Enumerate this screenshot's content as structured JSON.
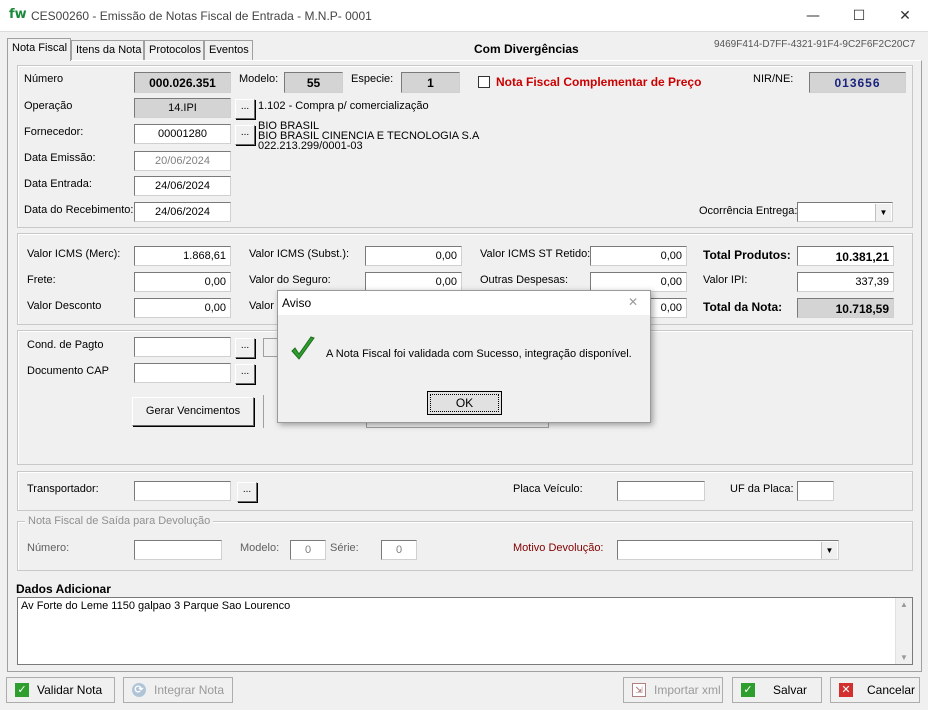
{
  "window": {
    "app_icon": "fw",
    "title": "CES00260 - Emissão de  Notas  Fiscal de Entrada - M.N.P- 0001",
    "minimize": "—",
    "maximize": "☐",
    "close": "✕"
  },
  "tabs": [
    "Nota Fiscal",
    "Itens da Nota",
    "Protocolos",
    "Eventos"
  ],
  "header": {
    "status": "Com Divergências",
    "guid": "9469F414-D7FF-4321-91F4-9C2F6F2C20C7"
  },
  "nota": {
    "numero_label": "Número",
    "numero": "000.026.351",
    "modelo_label": "Modelo:",
    "modelo": "55",
    "especie_label": "Especie:",
    "especie": "1",
    "complementar_label": "Nota Fiscal Complementar de Preço",
    "nir_label": "NIR/NE:",
    "nir": "013656",
    "operacao_label": "Operação",
    "operacao": "14.IPI",
    "operacao_desc": "1.102 - Compra p/ comercialização",
    "fornecedor_label": "Fornecedor:",
    "fornecedor": "00001280",
    "fornecedor_nome1": "BIO BRASIL",
    "fornecedor_nome2": "BIO BRASIL CINENCIA E TECNOLOGIA S.A",
    "fornecedor_cnpj": "022.213.299/0001-03",
    "data_emissao_label": "Data Emissão:",
    "data_emissao": "20/06/2024",
    "data_entrada_label": "Data Entrada:",
    "data_entrada": "24/06/2024",
    "data_recebimento_label": "Data do Recebimento:",
    "data_recebimento": "24/06/2024",
    "ocorrencia_label": "Ocorrência Entrega:",
    "ellipsis": "..."
  },
  "valores": {
    "icms_merc_label": "Valor ICMS (Merc):",
    "icms_merc": "1.868,61",
    "icms_subst_label": "Valor  ICMS (Subst.):",
    "icms_subst": "0,00",
    "icms_st_label": "Valor ICMS ST Retido:",
    "icms_st": "0,00",
    "total_produtos_label": "Total Produtos:",
    "total_produtos": "10.381,21",
    "frete_label": "Frete:",
    "frete": "0,00",
    "seguro_label": "Valor do Seguro:",
    "seguro": "0,00",
    "outras_label": "Outras Despesas:",
    "outras": "0,00",
    "ipi_label": "Valor IPI:",
    "ipi": "337,39",
    "desconto_label": "Valor Desconto",
    "desconto": "0,00",
    "valor_trunc_label": "Valor",
    "valor_trunc": "0,00",
    "total_nota_label": "Total da Nota:",
    "total_nota": "10.718,59"
  },
  "pagamento": {
    "cond_label": "Cond. de Pagto",
    "doc_label": "Documento CAP",
    "gerar_label": "Gerar Vencimentos"
  },
  "transporte": {
    "transportador_label": "Transportador:",
    "placa_label": "Placa Veículo:",
    "uf_label": "UF da Placa:"
  },
  "devolucao": {
    "group_label": "Nota Fiscal de Saída para Devolução",
    "numero_label": "Número:",
    "modelo_label": "Modelo:",
    "modelo": "0",
    "serie_label": "Série:",
    "serie": "0",
    "motivo_label": "Motivo Devolução:"
  },
  "adicionais": {
    "label": "Dados Adicionar",
    "text": "Av Forte do Leme 1150 galpao 3 Parque Sao Lourenco"
  },
  "buttons": {
    "validar": "Validar Nota",
    "integrar": "Integrar Nota",
    "importar": "Importar xml",
    "salvar": "Salvar",
    "cancelar": "Cancelar"
  },
  "dialog": {
    "title": "Aviso",
    "message": "A Nota Fiscal foi validada com Sucesso, integração disponível.",
    "ok": "OK",
    "close": "✕"
  },
  "colors": {
    "red_label": "#cc0000",
    "nir_blue": "#1a237e",
    "check_green": "#2e9e2e",
    "cancel_red": "#d32f2f"
  }
}
